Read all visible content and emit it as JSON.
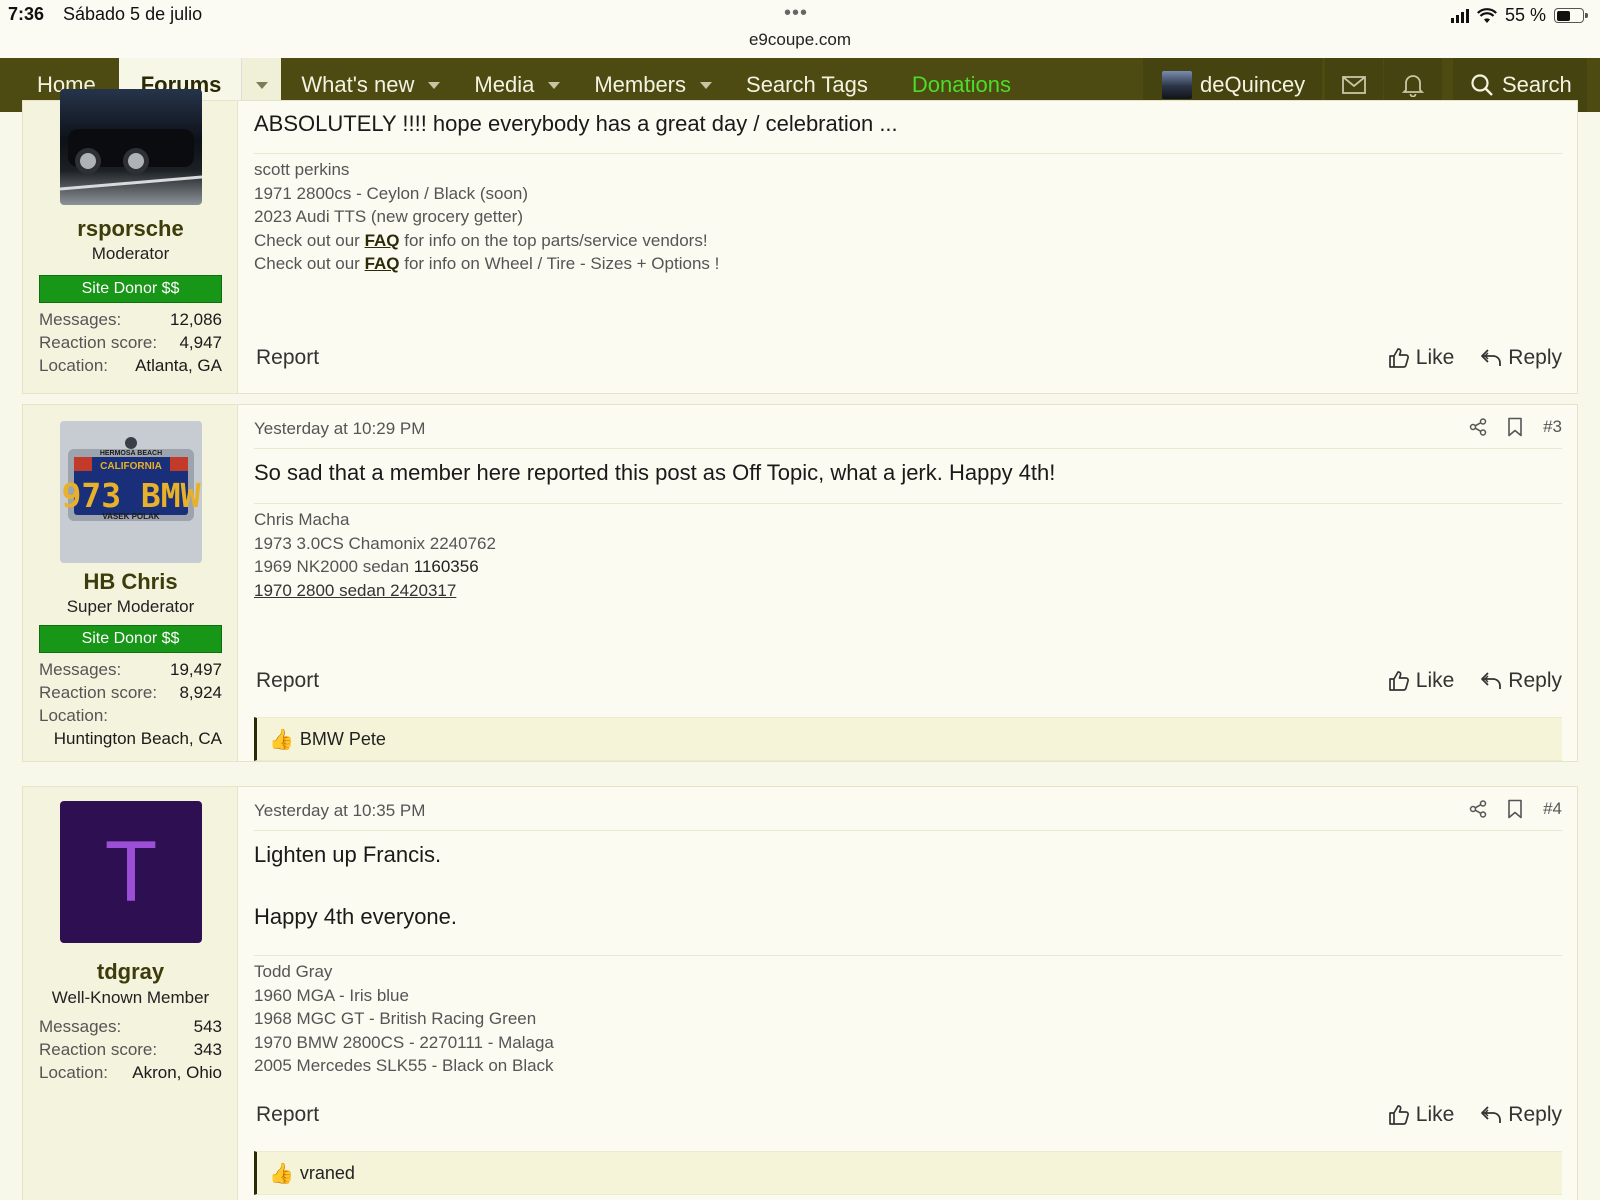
{
  "status_bar": {
    "time": "7:36",
    "date": "Sábado 5 de julio",
    "url": "e9coupe.com",
    "battery": "55 %"
  },
  "nav": {
    "home": "Home",
    "forums": "Forums",
    "whats_new": "What's new",
    "media": "Media",
    "members": "Members",
    "search_tags": "Search Tags",
    "donations": "Donations",
    "username": "deQuincey",
    "search": "Search"
  },
  "posts": [
    {
      "username": "rsporsche",
      "title": "Moderator",
      "donor_badge": "Site Donor $$",
      "stats": [
        {
          "label": "Messages:",
          "value": "12,086"
        },
        {
          "label": "Reaction score:",
          "value": "4,947"
        },
        {
          "label": "Location:",
          "value": "Atlanta, GA"
        }
      ],
      "message": "ABSOLUTELY !!!! hope everybody has a great day / celebration ...",
      "signature": {
        "line1": "scott perkins",
        "line2": "1971 2800cs - Ceylon / Black (soon)",
        "line3": "2023 Audi TTS (new grocery getter)",
        "line4_pre": "Check out our ",
        "line4_link": "FAQ",
        "line4_post": " for info on the top parts/service vendors!",
        "line5_pre": "Check out our ",
        "line5_link": "FAQ",
        "line5_post": " for info on Wheel / Tire - Sizes + Options !"
      },
      "report": "Report",
      "like": "Like",
      "reply": "Reply"
    },
    {
      "username": "HB Chris",
      "title": "Super Moderator",
      "donor_badge": "Site Donor $$",
      "avatar_plate_text": "973 BMW",
      "avatar_plate_state": "CALIFORNIA",
      "avatar_plate_top": "HERMOSA BEACH",
      "avatar_plate_frame": "VASEK POLAK",
      "stats": [
        {
          "label": "Messages:",
          "value": "19,497"
        },
        {
          "label": "Reaction score:",
          "value": "8,924"
        },
        {
          "label": "Location:",
          "value": ""
        }
      ],
      "location_value": "Huntington Beach, CA",
      "timestamp": "Yesterday at 10:29 PM",
      "post_number": "#3",
      "message": "So sad that a member here reported this post as Off Topic, what a jerk. Happy 4th!",
      "signature": {
        "line1": "Chris Macha",
        "line2": "1973 3.0CS Chamonix 2240762",
        "line3_pre": "1969 NK2000 sedan ",
        "line3_num": "1160356",
        "line4": "1970 2800 sedan 2420317"
      },
      "report": "Report",
      "like": "Like",
      "reply": "Reply",
      "reactions": "BMW Pete"
    },
    {
      "username": "tdgray",
      "title": "Well-Known Member",
      "avatar_letter": "T",
      "stats": [
        {
          "label": "Messages:",
          "value": "543"
        },
        {
          "label": "Reaction score:",
          "value": "343"
        },
        {
          "label": "Location:",
          "value": "Akron, Ohio"
        }
      ],
      "timestamp": "Yesterday at 10:35 PM",
      "post_number": "#4",
      "message_line1": "Lighten up Francis.",
      "message_line2": "Happy 4th everyone.",
      "signature": {
        "line1": "Todd Gray",
        "line2": "1960 MGA - Iris blue",
        "line3": "1968 MGC GT - British Racing Green",
        "line4": "1970 BMW 2800CS - 2270111 - Malaga",
        "line5": "2005 Mercedes SLK55 - Black on Black"
      },
      "report": "Report",
      "like": "Like",
      "reply": "Reply",
      "reactions": "vraned"
    }
  ],
  "colors": {
    "nav_bg": "#4d4b12",
    "donations": "#4ddc2a",
    "donor_badge": "#179617",
    "avatar_t_bg": "#2d0f52",
    "avatar_t_fg": "#9b4fd6"
  }
}
